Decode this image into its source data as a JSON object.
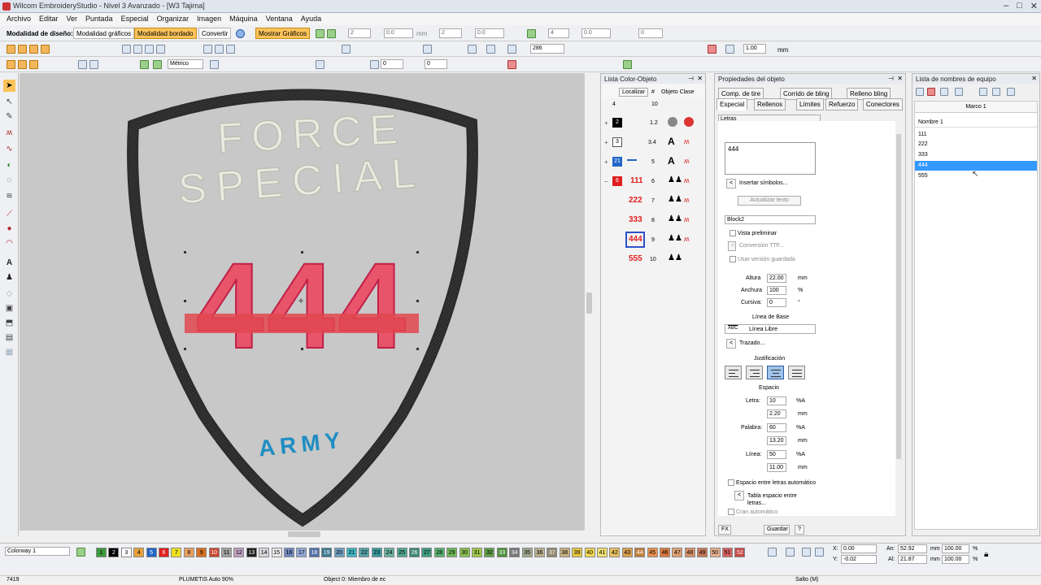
{
  "window": {
    "title": "Wilcom EmbroideryStudio - Nivel 3 Avanzado - [W3     Tajima]"
  },
  "menu": [
    "Archivo",
    "Editar",
    "Ver",
    "Puntada",
    "Especial",
    "Organizar",
    "Imagen",
    "Máquina",
    "Ventana",
    "Ayuda"
  ],
  "toolbar1": {
    "design_mode_label": "Modalidad de diseño:",
    "graphics_mode": "Modalidad gráficos",
    "embroidery_mode": "Modalidad bordado",
    "convert": "Convertir",
    "show_graphics": "Mostrar Gráficos",
    "v1": "2",
    "v2": "0.0",
    "unit1": "mm",
    "v3": "2",
    "v4": "0.0",
    "v5": "4",
    "v6": "0.0",
    "v7": "0"
  },
  "toolbar2": {
    "zoom": "286",
    "scale": "1.00",
    "unit": "mm"
  },
  "toolbar3": {
    "units": "Métrico",
    "v1": "0",
    "v2": "0"
  },
  "canvas": {
    "top_line1": "FORCE",
    "top_line2": "SPECIAL",
    "number": "444",
    "bottom": "ARMY"
  },
  "colorlist": {
    "title": "Lista Color-Objeto",
    "localizar": "Localizar",
    "hash": "#",
    "obj_clase": "Objeto Clase",
    "hdr_left": "4",
    "hdr_num": "10",
    "rows": [
      {
        "color": "2",
        "num": "1.2",
        "label": ""
      },
      {
        "color": "3",
        "num": "3.4",
        "label": ""
      },
      {
        "color": "21",
        "num": "5",
        "label": ""
      },
      {
        "color": "6",
        "num": "6",
        "label": "111"
      },
      {
        "color": "",
        "num": "7",
        "label": "222"
      },
      {
        "color": "",
        "num": "8",
        "label": "333"
      },
      {
        "color": "",
        "num": "9",
        "label": "444"
      },
      {
        "color": "",
        "num": "10",
        "label": "555"
      }
    ]
  },
  "props": {
    "title": "Propiedades del objeto",
    "tabs_top": [
      "Comp. de tire",
      "Corrido de bling",
      "Relleno bling"
    ],
    "tabs_bottom": [
      "Especial",
      "Rellenos",
      "Límites",
      "Refuerzo",
      "Conectores"
    ],
    "dropdown": "Letras",
    "text_value": "444",
    "insert_symbols": "Insertar símbolos...",
    "update_text": "Actualizar texto",
    "font": "Block2",
    "preview": "Vista preliminar",
    "ttf_conv": "Conversión TTF...",
    "use_saved": "Usar versión guardada",
    "height_label": "Altura",
    "height": "22.00",
    "height_unit": "mm",
    "width_label": "Anchura",
    "width": "100",
    "width_unit": "%",
    "italic_label": "Cursiva:",
    "italic": "0",
    "italic_unit": "°",
    "baseline_label": "Línea de Base",
    "baseline_abc": "ABC",
    "baseline": "Línea Libre",
    "trazado": "Trazado...",
    "justify_label": "Justificación",
    "spacing_label": "Espacio",
    "letter_label": "Letra:",
    "letter_pct": "10",
    "letter_mm": "2.20",
    "word_label": "Palabra:",
    "word_pct": "60",
    "word_mm": "13.20",
    "line_label": "Línea:",
    "line_pct": "50",
    "line_mm": "11.00",
    "pct_a": "%A",
    "mm": "mm",
    "auto_spacing": "Espacio entre letras automático",
    "spacing_table": "Tabla espacio entre letras...",
    "auto_crane": "Cran automático",
    "fx": "FX",
    "save": "Guardar",
    "help": "?"
  },
  "team": {
    "title": "Lista de nombres de equipo",
    "frame": "Marco 1",
    "col": "Nombre 1",
    "names": [
      "111",
      "222",
      "333",
      "444",
      "555"
    ],
    "selected": 3
  },
  "colorbar": {
    "colorway": "Colorway 1",
    "swatches": [
      {
        "n": "1",
        "c": "#3c9a3c",
        "t": "#000"
      },
      {
        "n": "2",
        "c": "#000",
        "t": "#fff"
      },
      {
        "n": "3",
        "c": "#fff",
        "t": "#000"
      },
      {
        "n": "4",
        "c": "#e8a23c",
        "t": "#000"
      },
      {
        "n": "5",
        "c": "#2266c8",
        "t": "#fff"
      },
      {
        "n": "6",
        "c": "#e02020",
        "t": "#fff"
      },
      {
        "n": "7",
        "c": "#f0e020",
        "t": "#000"
      },
      {
        "n": "8",
        "c": "#e8a060",
        "t": "#000"
      },
      {
        "n": "9",
        "c": "#d87020",
        "t": "#000"
      },
      {
        "n": "10",
        "c": "#c84830",
        "t": "#fff"
      },
      {
        "n": "11",
        "c": "#a0a0a0",
        "t": "#000"
      },
      {
        "n": "12",
        "c": "#c0a0c0",
        "t": "#000"
      },
      {
        "n": "13",
        "c": "#202020",
        "t": "#fff"
      },
      {
        "n": "14",
        "c": "#d8d8d8",
        "t": "#000"
      },
      {
        "n": "15",
        "c": "#e8e8e8",
        "t": "#000"
      },
      {
        "n": "16",
        "c": "#7088c0",
        "t": "#000"
      },
      {
        "n": "17",
        "c": "#90a8d8",
        "t": "#000"
      },
      {
        "n": "18",
        "c": "#5070a8",
        "t": "#fff"
      },
      {
        "n": "19",
        "c": "#3c7890",
        "t": "#fff"
      },
      {
        "n": "20",
        "c": "#70a0c0",
        "t": "#000"
      },
      {
        "n": "21",
        "c": "#40b8c0",
        "t": "#000"
      },
      {
        "n": "22",
        "c": "#58a0a8",
        "t": "#000"
      },
      {
        "n": "23",
        "c": "#3c9aa0",
        "t": "#000"
      },
      {
        "n": "24",
        "c": "#68b0a0",
        "t": "#000"
      },
      {
        "n": "25",
        "c": "#50a890",
        "t": "#000"
      },
      {
        "n": "26",
        "c": "#3c8870",
        "t": "#fff"
      },
      {
        "n": "27",
        "c": "#40a080",
        "t": "#000"
      },
      {
        "n": "28",
        "c": "#58b070",
        "t": "#000"
      },
      {
        "n": "29",
        "c": "#70b858",
        "t": "#000"
      },
      {
        "n": "30",
        "c": "#88c050",
        "t": "#000"
      },
      {
        "n": "31",
        "c": "#a0c848",
        "t": "#000"
      },
      {
        "n": "32",
        "c": "#60a048",
        "t": "#000"
      },
      {
        "n": "33",
        "c": "#50903c",
        "t": "#fff"
      },
      {
        "n": "34",
        "c": "#787878",
        "t": "#fff"
      },
      {
        "n": "35",
        "c": "#a0a890",
        "t": "#000"
      },
      {
        "n": "36",
        "c": "#b8b090",
        "t": "#000"
      },
      {
        "n": "37",
        "c": "#908870",
        "t": "#fff"
      },
      {
        "n": "38",
        "c": "#c8b080",
        "t": "#000"
      },
      {
        "n": "39",
        "c": "#e8c840",
        "t": "#000"
      },
      {
        "n": "40",
        "c": "#f0d850",
        "t": "#000"
      },
      {
        "n": "41",
        "c": "#f0e070",
        "t": "#000"
      },
      {
        "n": "42",
        "c": "#e8c060",
        "t": "#000"
      },
      {
        "n": "43",
        "c": "#d8a050",
        "t": "#000"
      },
      {
        "n": "44",
        "c": "#c08040",
        "t": "#fff"
      },
      {
        "n": "45",
        "c": "#e89050",
        "t": "#000"
      },
      {
        "n": "46",
        "c": "#d87840",
        "t": "#000"
      },
      {
        "n": "47",
        "c": "#e0a070",
        "t": "#000"
      },
      {
        "n": "48",
        "c": "#d89068",
        "t": "#000"
      },
      {
        "n": "49",
        "c": "#c87858",
        "t": "#000"
      },
      {
        "n": "50",
        "c": "#e8b090",
        "t": "#000"
      },
      {
        "n": "51",
        "c": "#d86060",
        "t": "#000"
      },
      {
        "n": "52",
        "c": "#c84848",
        "t": "#fff"
      }
    ],
    "x_label": "X:",
    "x": "0.00",
    "y_label": "Y:",
    "y": "-0.02",
    "an_label": "An:",
    "an": "52.92",
    "al_label": "Al:",
    "al": "21.87",
    "mm": "mm",
    "p1": "100.00",
    "p2": "100.00",
    "pct": "%"
  },
  "status": {
    "count": "7419",
    "stitch": "PLUMETIS Auto 90%",
    "object": "Object 0: Miembro de ec",
    "salto": "Salto (M)"
  }
}
